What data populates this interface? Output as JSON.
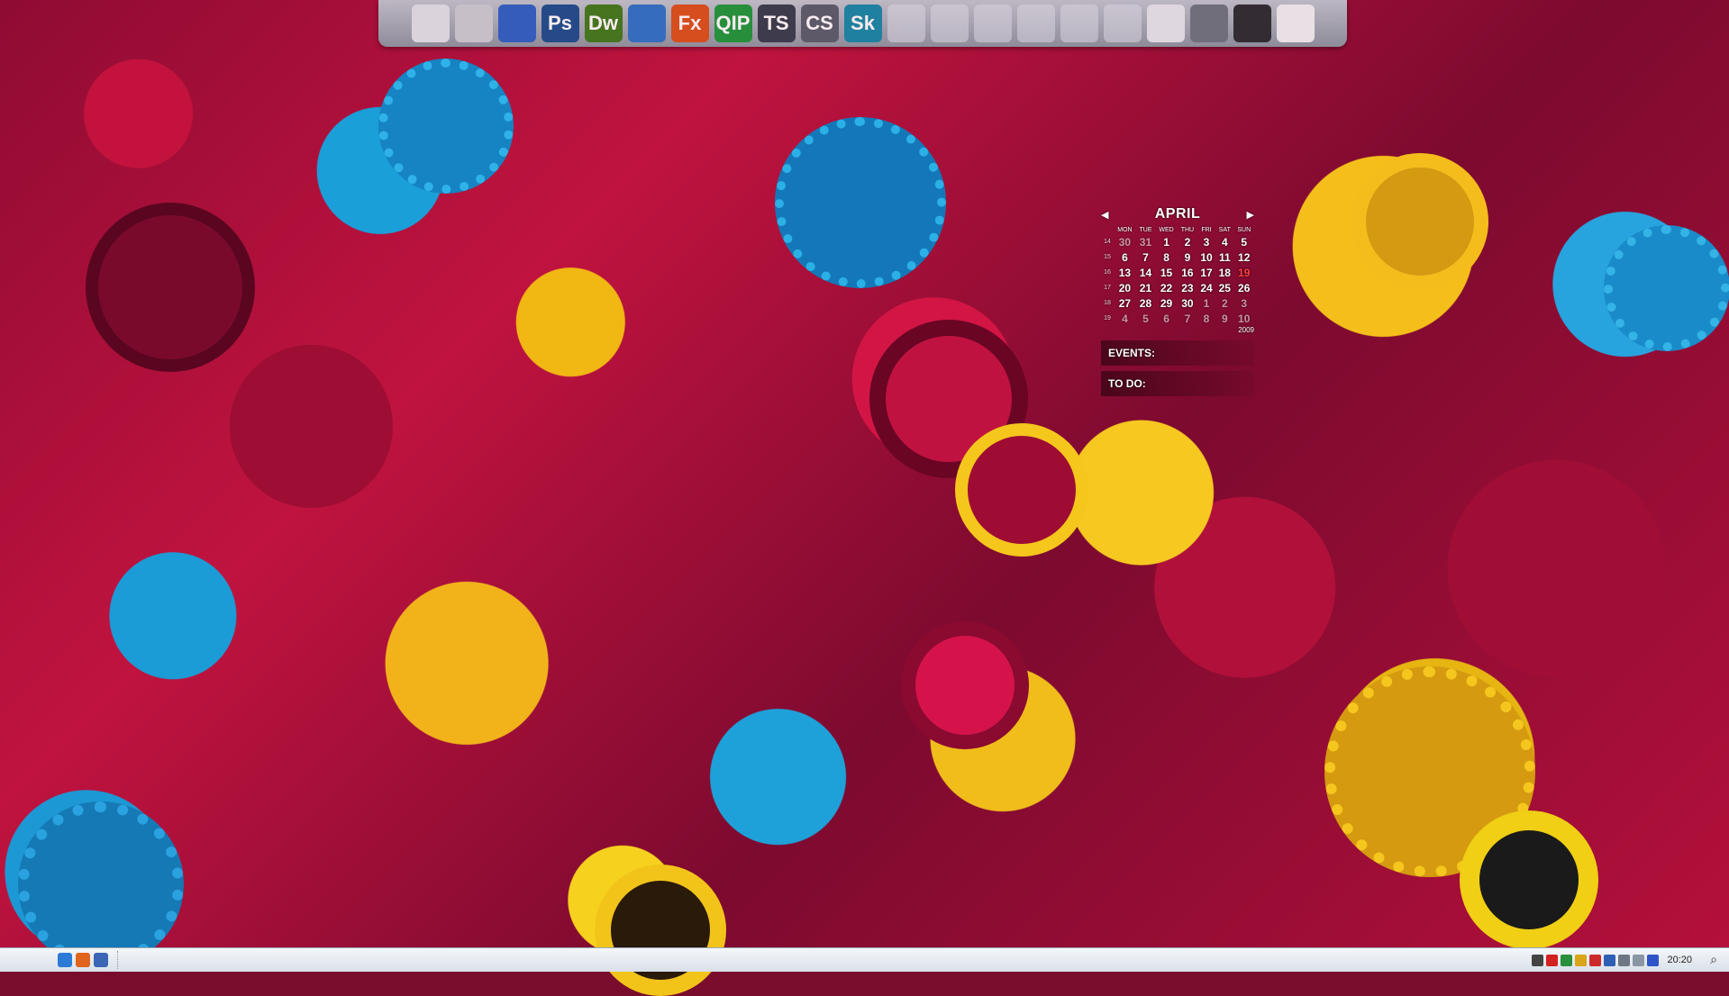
{
  "dock": {
    "items": [
      {
        "name": "notes-icon",
        "label": "",
        "color": "#dfe4ea"
      },
      {
        "name": "drive-icon",
        "label": "",
        "color": "#c9ced4"
      },
      {
        "name": "tower-icon",
        "label": "",
        "color": "#2b63c6"
      },
      {
        "name": "photoshop-icon",
        "label": "Ps",
        "color": "#1b4f8f"
      },
      {
        "name": "dreamweaver-icon",
        "label": "Dw",
        "color": "#3d7d1d"
      },
      {
        "name": "globe-app-icon",
        "label": "",
        "color": "#2b74c7"
      },
      {
        "name": "firefox-icon",
        "label": "Fx",
        "color": "#d9521c"
      },
      {
        "name": "qip-icon",
        "label": "QIP",
        "color": "#1b9a3c"
      },
      {
        "name": "teamspeak-icon",
        "label": "TS",
        "color": "#343f4e"
      },
      {
        "name": "counter-strike-icon",
        "label": "CS",
        "color": "#56606d"
      },
      {
        "name": "skype-icon",
        "label": "Sk",
        "color": "#148aa8"
      },
      {
        "name": "info-icon",
        "label": "",
        "color": "faded"
      },
      {
        "name": "music-icon",
        "label": "",
        "color": "faded"
      },
      {
        "name": "user-icon",
        "label": "",
        "color": "faded"
      },
      {
        "name": "network-icon",
        "label": "",
        "color": "faded"
      },
      {
        "name": "pictures-icon",
        "label": "",
        "color": "faded"
      },
      {
        "name": "documents-icon",
        "label": "",
        "color": "faded"
      },
      {
        "name": "recycle-bin-icon",
        "label": "",
        "color": "#e4e9ee"
      },
      {
        "name": "tools-icon",
        "label": "",
        "color": "#6e7782"
      },
      {
        "name": "keyboard-icon",
        "label": "",
        "color": "#2c2f33"
      },
      {
        "name": "window-icon",
        "label": "",
        "color": "#f0f2f4"
      }
    ]
  },
  "calendar": {
    "month": "APRIL",
    "prev_arrow": "◀",
    "next_arrow": "▶",
    "weekdays": [
      "MON",
      "TUE",
      "WED",
      "THU",
      "FRI",
      "SAT",
      "SUN"
    ],
    "weeks": [
      {
        "week": "14",
        "days": [
          "30",
          "31",
          "1",
          "2",
          "3",
          "4",
          "5"
        ],
        "dim": [
          0,
          1
        ]
      },
      {
        "week": "15",
        "days": [
          "6",
          "7",
          "8",
          "9",
          "10",
          "11",
          "12"
        ],
        "dim": []
      },
      {
        "week": "16",
        "days": [
          "13",
          "14",
          "15",
          "16",
          "17",
          "18",
          "19"
        ],
        "dim": []
      },
      {
        "week": "17",
        "days": [
          "20",
          "21",
          "22",
          "23",
          "24",
          "25",
          "26"
        ],
        "dim": []
      },
      {
        "week": "18",
        "days": [
          "27",
          "28",
          "29",
          "30",
          "1",
          "2",
          "3"
        ],
        "dim": [
          4,
          5,
          6
        ]
      },
      {
        "week": "19",
        "days": [
          "4",
          "5",
          "6",
          "7",
          "8",
          "9",
          "10"
        ],
        "dim": [
          0,
          1,
          2,
          3,
          4,
          5,
          6
        ]
      }
    ],
    "today_index": [
      2,
      6
    ],
    "year": "2009",
    "events_label": "EVENTS:",
    "todo_label": "TO DO:"
  },
  "taskbar": {
    "start_glyph": "",
    "quicklaunch": [
      {
        "name": "ie-icon",
        "color": "#2c7bd6"
      },
      {
        "name": "firefox-small-icon",
        "color": "#e0641c"
      },
      {
        "name": "show-desktop-icon",
        "color": "#3a67b5"
      }
    ],
    "tray": [
      {
        "name": "add-icon",
        "color": "#444444"
      },
      {
        "name": "antivirus-icon",
        "color": "#d42020"
      },
      {
        "name": "network-tray-icon",
        "color": "#2a8f3a"
      },
      {
        "name": "shield-icon",
        "color": "#d9a418"
      },
      {
        "name": "flag-icon",
        "color": "#cc2a2a"
      },
      {
        "name": "language-icon",
        "color": "#2f5fb5"
      },
      {
        "name": "volume-icon",
        "color": "#6d7884"
      },
      {
        "name": "power-icon",
        "color": "#8a96a3"
      },
      {
        "name": "bluetooth-icon",
        "color": "#2d55c8"
      }
    ],
    "clock": "20:20",
    "search_glyph": "⌕"
  }
}
